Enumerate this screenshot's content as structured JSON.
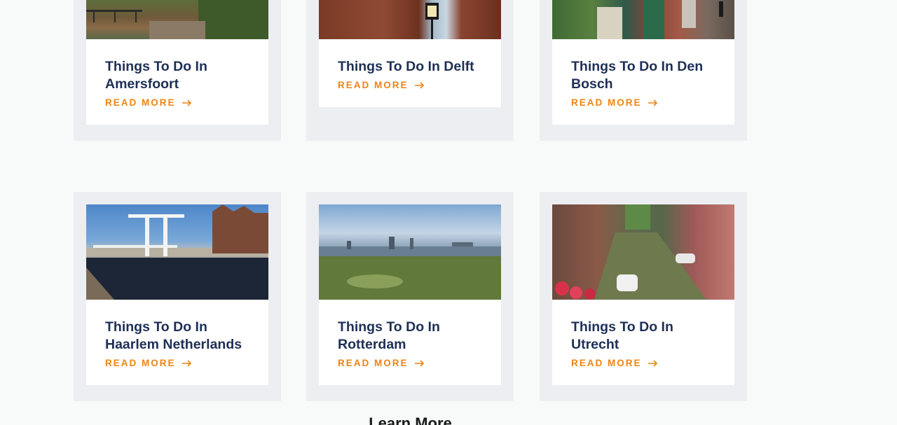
{
  "cards": [
    {
      "title": "Things To Do In Amersfoort",
      "read_more": "READ MORE",
      "image_icon": "amersfoort-canal-image"
    },
    {
      "title": "Things To Do In Delft",
      "read_more": "READ MORE",
      "image_icon": "delft-church-image"
    },
    {
      "title": "Things To Do In Den Bosch",
      "read_more": "READ MORE",
      "image_icon": "den-bosch-street-image"
    },
    {
      "title": "Things To Do In Haarlem Netherlands",
      "read_more": "READ MORE",
      "image_icon": "haarlem-drawbridge-image"
    },
    {
      "title": "Things To Do In Rotterdam",
      "read_more": "READ MORE",
      "image_icon": "rotterdam-skyline-image"
    },
    {
      "title": "Things To Do In Utrecht",
      "read_more": "READ MORE",
      "image_icon": "utrecht-canal-image"
    }
  ],
  "learn_more": "Learn More",
  "colors": {
    "title": "#1e2f56",
    "accent": "#ef8413",
    "card_bg": "#eceef2",
    "page_bg": "#f8fafa"
  }
}
